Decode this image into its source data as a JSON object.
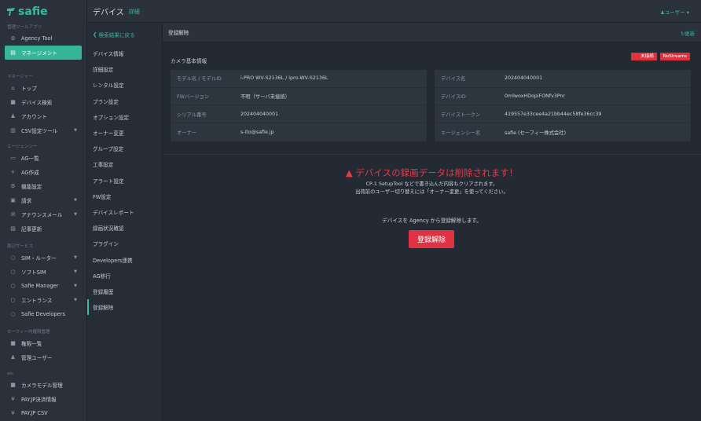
{
  "app": {
    "logo_text": "safie",
    "brand_color": "#36b9a0"
  },
  "header": {
    "title": "デバイス",
    "subtitle": "詳細",
    "user_menu": "ユーザー"
  },
  "sidebar": {
    "sections": [
      {
        "label": "管理ツールアプリ",
        "items": [
          {
            "label": "Agency Tool",
            "icon": "gear-icon"
          },
          {
            "label": "マネージメント",
            "icon": "grid-icon",
            "active": true
          }
        ]
      },
      {
        "label": "マネージャー",
        "items": [
          {
            "label": "トップ",
            "icon": "home-icon"
          },
          {
            "label": "デバイス検索",
            "icon": "camera-icon"
          },
          {
            "label": "アカウント",
            "icon": "user-icon"
          },
          {
            "label": "CSV設定ツール",
            "icon": "file-icon",
            "caret": true
          }
        ]
      },
      {
        "label": "エージェンシー",
        "items": [
          {
            "label": "AG一覧",
            "icon": "inbox-icon"
          },
          {
            "label": "AG作成",
            "icon": "plus-icon"
          },
          {
            "label": "機能設定",
            "icon": "cogs-icon"
          },
          {
            "label": "請求",
            "icon": "bill-icon",
            "caret": true
          },
          {
            "label": "アナウンスメール",
            "icon": "mail-icon",
            "caret": true
          },
          {
            "label": "記事更新",
            "icon": "edit-icon"
          }
        ]
      },
      {
        "label": "周辺サービス",
        "items": [
          {
            "label": "SIM・ルーター",
            "icon": "circle-icon",
            "caret": true
          },
          {
            "label": "ソフトSIM",
            "icon": "circle-icon",
            "caret": true
          },
          {
            "label": "Safie Manager",
            "icon": "circle-icon",
            "caret": true
          },
          {
            "label": "エントランス",
            "icon": "circle-icon",
            "caret": true
          },
          {
            "label": "Safie Developers",
            "icon": "circle-icon"
          }
        ]
      },
      {
        "label": "セーフィー内権限管理",
        "items": [
          {
            "label": "権限一覧",
            "icon": "lock-icon"
          },
          {
            "label": "管理ユーザー",
            "icon": "user-icon"
          }
        ]
      },
      {
        "label": "etc",
        "items": [
          {
            "label": "カメラモデル管理",
            "icon": "camera-icon"
          },
          {
            "label": "PAY.JP決済情報",
            "icon": "yen-icon"
          },
          {
            "label": "PAY.JP CSV",
            "icon": "yen-icon"
          }
        ]
      }
    ]
  },
  "submenu": {
    "back_label": "検索結果に戻る",
    "items": [
      "デバイス情報",
      "詳細設定",
      "レンタル設定",
      "プラン設定",
      "オプション設定",
      "オーナー変更",
      "グループ設定",
      "工事設定",
      "アラート設定",
      "FW設定",
      "デバイスレポート",
      "録画状況確認",
      "プラグイン",
      "Developers連携",
      "AG移行",
      "登録履歴",
      "登録解除"
    ],
    "active_index": 16
  },
  "main": {
    "section_title": "登録解除",
    "refresh_label": "更新",
    "card_title": "カメラ基本情報",
    "badges": {
      "offline": "未接続",
      "nostreams": "NoStreams"
    },
    "left_rows": [
      {
        "key": "モデル名 / モデルID",
        "value": "i-PRO WV-S2136L / ipro-WV-S2136L"
      },
      {
        "key": "FWバージョン",
        "value": "不明（サーバ未接続）"
      },
      {
        "key": "シリアル番号",
        "value": "202404040001"
      },
      {
        "key": "オーナー",
        "value": "s-ito@safie.jp"
      }
    ],
    "right_rows": [
      {
        "key": "デバイス名",
        "value": "202404040001"
      },
      {
        "key": "デバイスID",
        "value": "0mlwoxHDopiFONfv3Pnr"
      },
      {
        "key": "デバイストークン",
        "value": "419557e33cee4a21bb44ec58fe36cc39"
      },
      {
        "key": "エージェンシー名",
        "value": "safie (セーフィー株式会社)"
      }
    ],
    "warning_title": "デバイスの録画データは削除されます！",
    "warning_line1": "CP-1 SetupTool などで書き込んだ内容もクリアされます。",
    "warning_line2": "出荷前のユーザー切り替えには「オーナー変更」を使ってください。",
    "agency_note": "デバイスを Agency から登録解除します。",
    "unregister_button": "登録解除"
  }
}
